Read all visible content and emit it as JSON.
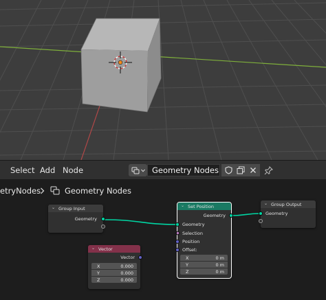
{
  "header": {
    "menus": [
      "Select",
      "Add",
      "Node"
    ],
    "tree_name": "Geometry Nodes"
  },
  "breadcrumb": {
    "items": [
      "etryNodes",
      "Geometry Nodes"
    ]
  },
  "nodes": {
    "group_input": {
      "title": "Group Input",
      "outputs": [
        "Geometry"
      ]
    },
    "set_position": {
      "title": "Set Position",
      "output": "Geometry",
      "inputs": [
        "Geometry",
        "Selection",
        "Position",
        "Offset:"
      ],
      "offset": [
        {
          "label": "X",
          "value": "0 m"
        },
        {
          "label": "Y",
          "value": "0 m"
        },
        {
          "label": "Z",
          "value": "0 m"
        }
      ]
    },
    "group_output": {
      "title": "Group Output",
      "inputs": [
        "Geometry"
      ]
    },
    "vector": {
      "title": "Vector",
      "output": "Vector",
      "fields": [
        {
          "label": "X",
          "value": "0.000"
        },
        {
          "label": "Y",
          "value": "0.000"
        },
        {
          "label": "Z",
          "value": "0.000"
        }
      ]
    }
  },
  "colors": {
    "geometry_socket": "#00d6a3",
    "vector_socket": "#6363c7",
    "bool_socket": "#ce8ad4",
    "geometry_node_header": "#1a7a63",
    "input_node_header": "#83314a",
    "group_node_header": "#3c3c3c",
    "x_axis": "#b04848",
    "y_axis": "#7fb03b",
    "selected_outline": "#ffffff"
  }
}
